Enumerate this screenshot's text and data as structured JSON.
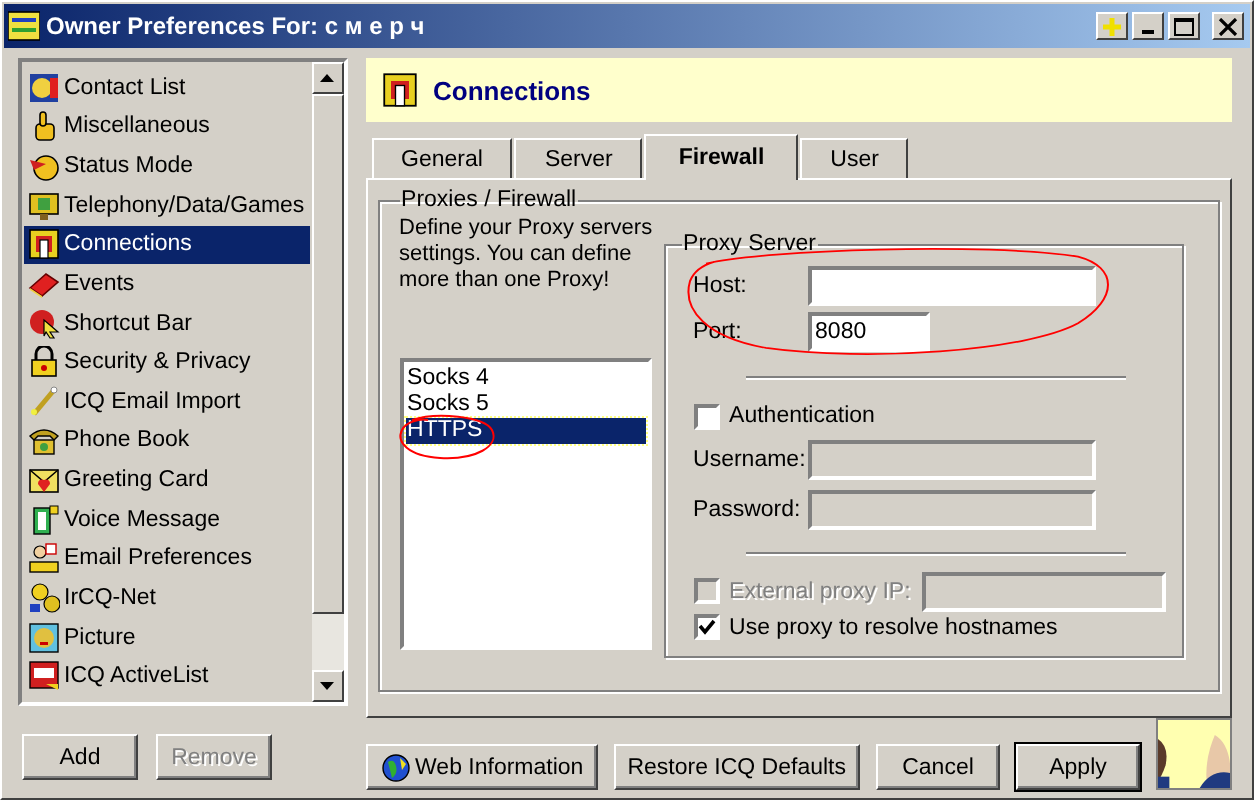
{
  "window": {
    "title": "Owner Preferences For: с м е р ч"
  },
  "sidebar": {
    "items": [
      {
        "label": "Contact List",
        "selected": false
      },
      {
        "label": "Miscellaneous",
        "selected": false
      },
      {
        "label": "Status Mode",
        "selected": false
      },
      {
        "label": "Telephony/Data/Games",
        "selected": false
      },
      {
        "label": "Connections",
        "selected": true
      },
      {
        "label": "Events",
        "selected": false
      },
      {
        "label": "Shortcut Bar",
        "selected": false
      },
      {
        "label": "Security & Privacy",
        "selected": false
      },
      {
        "label": "ICQ Email Import",
        "selected": false
      },
      {
        "label": "Phone Book",
        "selected": false
      },
      {
        "label": "Greeting Card",
        "selected": false
      },
      {
        "label": "Voice Message",
        "selected": false
      },
      {
        "label": "Email Preferences",
        "selected": false
      },
      {
        "label": "IrCQ-Net",
        "selected": false
      },
      {
        "label": "Picture",
        "selected": false
      },
      {
        "label": "ICQ ActiveList",
        "selected": false
      }
    ]
  },
  "sidebar_buttons": [
    {
      "label": "Add",
      "disabled": false
    },
    {
      "label": "Remove",
      "disabled": true
    }
  ],
  "header": {
    "title": "Connections"
  },
  "tabs": [
    {
      "label": "General",
      "selected": false
    },
    {
      "label": "Server",
      "selected": false
    },
    {
      "label": "Firewall",
      "selected": true
    },
    {
      "label": "User",
      "selected": false
    }
  ],
  "firewall": {
    "group_title": "Proxies / Firewall",
    "description": "Define your Proxy servers settings. You can define more than one Proxy!",
    "proxy_types": [
      {
        "label": "Socks 4",
        "selected": false,
        "circled": false
      },
      {
        "label": "Socks 5",
        "selected": false,
        "circled": false
      },
      {
        "label": "HTTPS",
        "selected": true,
        "circled": true
      }
    ],
    "proxy_server": {
      "title": "Proxy Server",
      "circled": true,
      "host": {
        "label": "Host:",
        "disabled": false
      },
      "port": {
        "label": "Port:",
        "value": "8080",
        "disabled": false
      },
      "authentication": {
        "label": "Authentication",
        "checked": false,
        "disabled": false
      },
      "username": {
        "label": "Username:",
        "disabled": true
      },
      "password": {
        "label": "Password:",
        "disabled": true
      },
      "external_proxy_ip": {
        "label": "External proxy IP:",
        "checked": false,
        "disabled": true
      },
      "resolve_hostnames": {
        "label": "Use proxy to resolve hostnames",
        "checked": true,
        "disabled": false
      }
    }
  },
  "footer_buttons": [
    {
      "label": "Web Information",
      "kind": "web",
      "default": false
    },
    {
      "label": "Restore ICQ Defaults",
      "kind": "plain",
      "default": false
    },
    {
      "label": "Cancel",
      "kind": "plain",
      "default": false
    },
    {
      "label": "Apply",
      "kind": "plain",
      "default": true
    }
  ]
}
